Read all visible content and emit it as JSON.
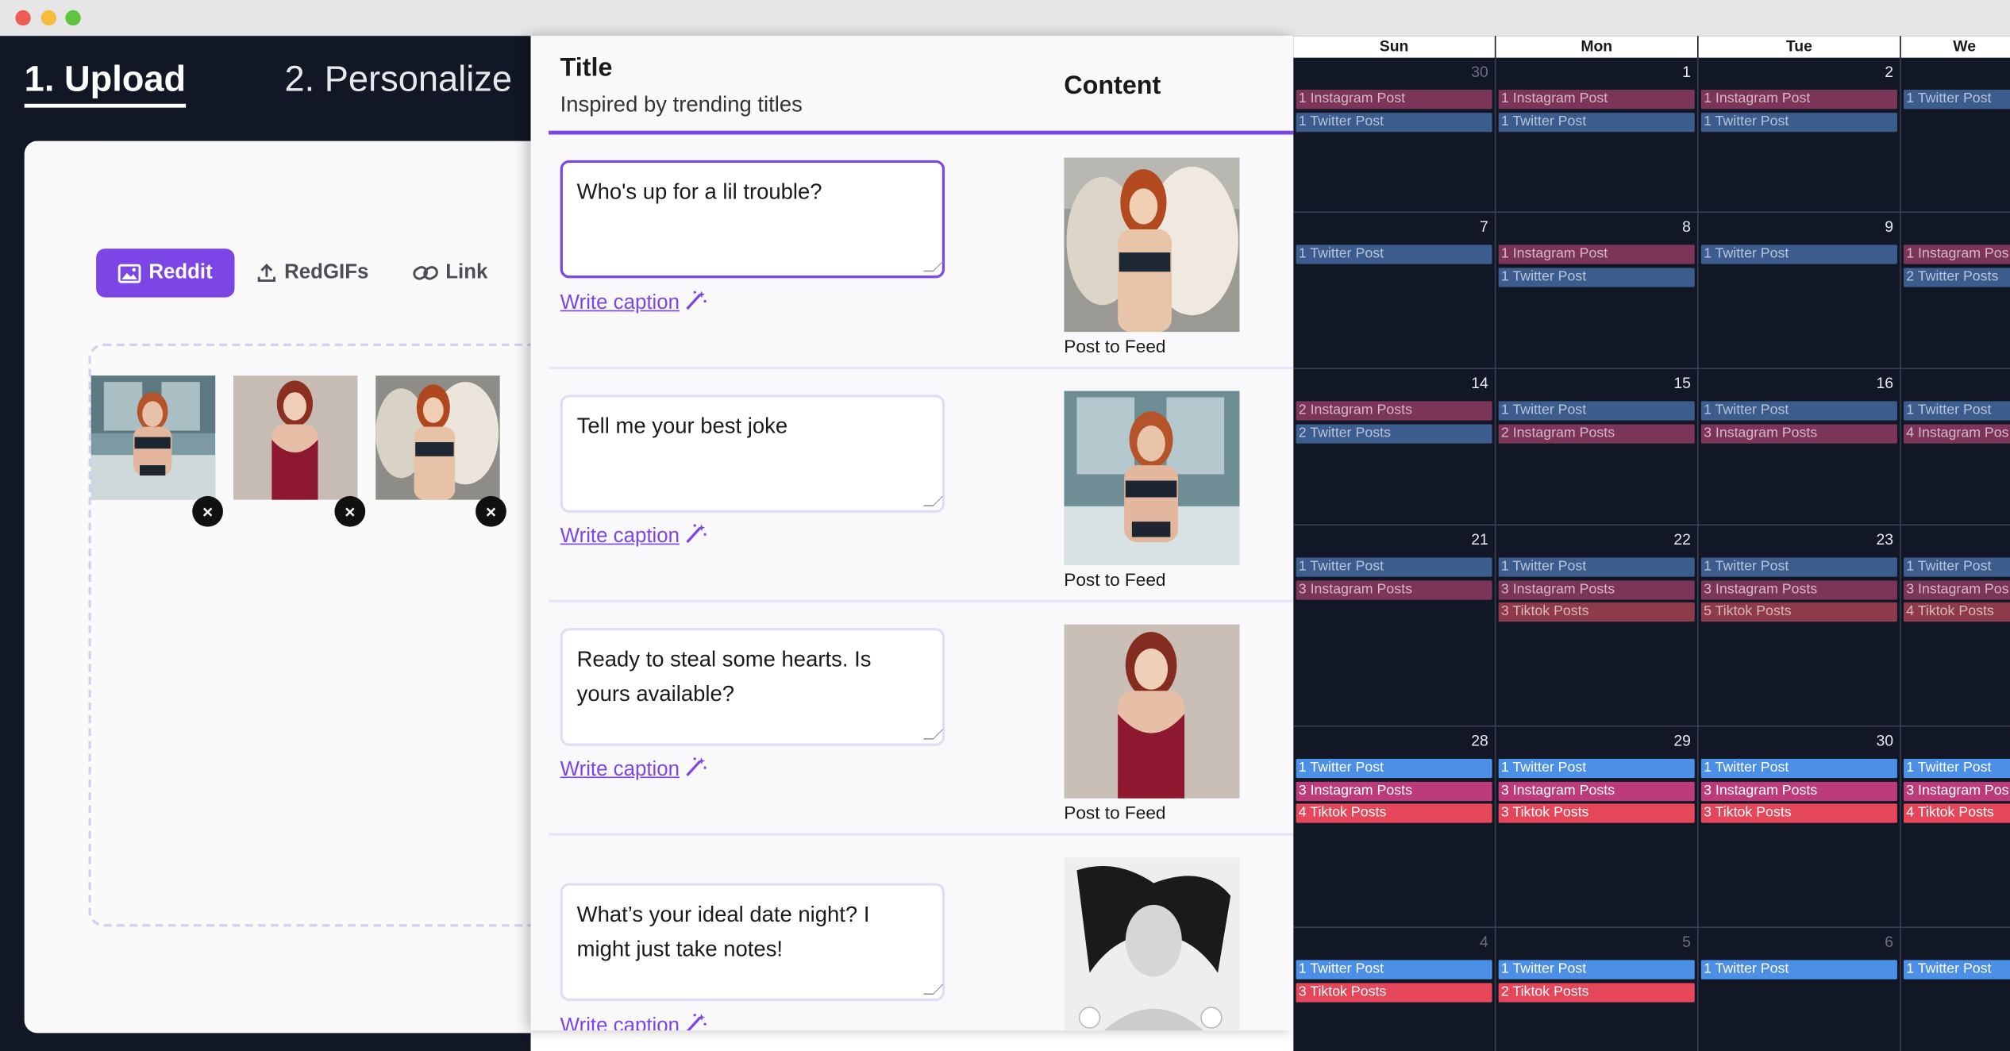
{
  "wizard": {
    "step1": "1. Upload",
    "step2": "2. Personalize"
  },
  "upload_tabs": [
    "Reddit",
    "RedGIFs",
    "Link"
  ],
  "thumb_close": "×",
  "posts_table": {
    "title_header": "Title",
    "title_sub": "Inspired by trending titles",
    "content_header": "Content",
    "write_caption": "Write caption",
    "post_to_feed": "Post to Feed",
    "rows": [
      "Who's up for a lil trouble?",
      "Tell me your best joke",
      "Ready to steal some hearts. Is yours available?",
      "What’s your ideal date night? I might just take notes!"
    ]
  },
  "calendar": {
    "weekdays": [
      "Sun",
      "Mon",
      "Tue",
      "We"
    ],
    "weeks": [
      {
        "days": [
          {
            "num": "30",
            "dim": true,
            "events": [
              [
                "1 Instagram Post",
                "ig-dim"
              ],
              [
                "1 Twitter Post",
                "tw-dim"
              ]
            ]
          },
          {
            "num": "1",
            "events": [
              [
                "1 Instagram Post",
                "ig-dim"
              ],
              [
                "1 Twitter Post",
                "tw-dim"
              ]
            ]
          },
          {
            "num": "2",
            "events": [
              [
                "1 Instagram Post",
                "ig-dim"
              ],
              [
                "1 Twitter Post",
                "tw-dim"
              ]
            ]
          },
          {
            "num": "",
            "events": [
              [
                "1 Twitter Post",
                "tw-dim"
              ]
            ]
          }
        ]
      },
      {
        "days": [
          {
            "num": "7",
            "events": [
              [
                "1 Twitter Post",
                "tw-dim"
              ]
            ]
          },
          {
            "num": "8",
            "events": [
              [
                "1 Instagram Post",
                "ig-dim"
              ],
              [
                "1 Twitter Post",
                "tw-dim"
              ]
            ]
          },
          {
            "num": "9",
            "events": [
              [
                "1 Twitter Post",
                "tw-dim"
              ]
            ]
          },
          {
            "num": "",
            "events": [
              [
                "1 Instagram Pos",
                "ig-dim"
              ],
              [
                "2 Twitter Posts",
                "tw-dim"
              ]
            ]
          }
        ]
      },
      {
        "days": [
          {
            "num": "14",
            "events": [
              [
                "2 Instagram Posts",
                "ig-dim"
              ],
              [
                "2 Twitter Posts",
                "tw-dim"
              ]
            ]
          },
          {
            "num": "15",
            "events": [
              [
                "1 Twitter Post",
                "tw-dim"
              ],
              [
                "2 Instagram Posts",
                "ig-dim"
              ]
            ]
          },
          {
            "num": "16",
            "events": [
              [
                "1 Twitter Post",
                "tw-dim"
              ],
              [
                "3 Instagram Posts",
                "ig-dim"
              ]
            ]
          },
          {
            "num": "",
            "events": [
              [
                "1 Twitter Post",
                "tw-dim"
              ],
              [
                "4 Instagram Pos",
                "ig-dim"
              ]
            ]
          }
        ]
      },
      {
        "days": [
          {
            "num": "21",
            "events": [
              [
                "1 Twitter Post",
                "tw-dim"
              ],
              [
                "3 Instagram Posts",
                "ig-dim"
              ]
            ]
          },
          {
            "num": "22",
            "events": [
              [
                "1 Twitter Post",
                "tw-dim"
              ],
              [
                "3 Instagram Posts",
                "ig-dim"
              ],
              [
                "3 Tiktok Posts",
                "tk-dim"
              ]
            ]
          },
          {
            "num": "23",
            "events": [
              [
                "1 Twitter Post",
                "tw-dim"
              ],
              [
                "3 Instagram Posts",
                "ig-dim"
              ],
              [
                "5 Tiktok Posts",
                "tk-dim"
              ]
            ]
          },
          {
            "num": "",
            "events": [
              [
                "1 Twitter Post",
                "tw-dim"
              ],
              [
                "3 Instagram Pos",
                "ig-dim"
              ],
              [
                "4 Tiktok Posts",
                "tk-dim"
              ]
            ]
          }
        ]
      },
      {
        "days": [
          {
            "num": "28",
            "events": [
              [
                "1 Twitter Post",
                "tw"
              ],
              [
                "3 Instagram Posts",
                "ig"
              ],
              [
                "4 Tiktok Posts",
                "tk"
              ]
            ]
          },
          {
            "num": "29",
            "events": [
              [
                "1 Twitter Post",
                "tw"
              ],
              [
                "3 Instagram Posts",
                "ig"
              ],
              [
                "3 Tiktok Posts",
                "tk"
              ]
            ]
          },
          {
            "num": "30",
            "events": [
              [
                "1 Twitter Post",
                "tw"
              ],
              [
                "3 Instagram Posts",
                "ig"
              ],
              [
                "3 Tiktok Posts",
                "tk"
              ]
            ]
          },
          {
            "num": "",
            "events": [
              [
                "1 Twitter Post",
                "tw"
              ],
              [
                "3 Instagram Pos",
                "ig"
              ],
              [
                "4 Tiktok Posts",
                "tk"
              ]
            ]
          }
        ]
      },
      {
        "days": [
          {
            "num": "4",
            "dim": true,
            "events": [
              [
                "1 Twitter Post",
                "tw"
              ],
              [
                "3 Tiktok Posts",
                "tk"
              ]
            ]
          },
          {
            "num": "5",
            "dim": true,
            "events": [
              [
                "1 Twitter Post",
                "tw"
              ],
              [
                "2 Tiktok Posts",
                "tk"
              ]
            ]
          },
          {
            "num": "6",
            "dim": true,
            "events": [
              [
                "1 Twitter Post",
                "tw"
              ]
            ]
          },
          {
            "num": "",
            "events": [
              [
                "1 Twitter Post",
                "tw"
              ]
            ]
          }
        ]
      }
    ]
  },
  "colors": {
    "accent": "#7c45e5",
    "dark_bg": "#121726",
    "twitter": "#4c8fe6",
    "instagram": "#bd3b78",
    "tiktok": "#e5465a"
  }
}
